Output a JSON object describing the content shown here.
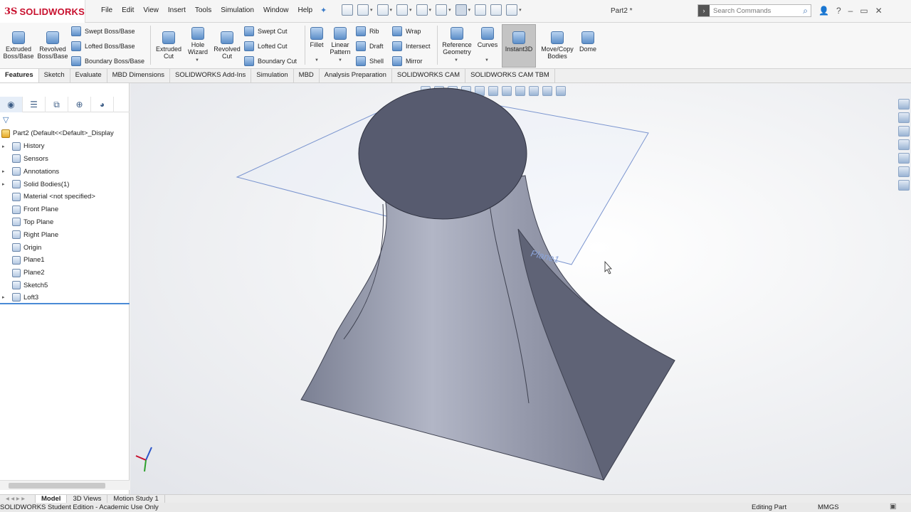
{
  "app": {
    "logo_ds": "3S",
    "logo_name": "SOLIDWORKS",
    "doc_title": "Part2 *"
  },
  "menu": [
    "File",
    "Edit",
    "View",
    "Insert",
    "Tools",
    "Simulation",
    "Window",
    "Help"
  ],
  "search": {
    "placeholder": "Search Commands"
  },
  "ribbon": {
    "extruded_boss": "Extruded Boss/Base",
    "revolved_boss": "Revolved Boss/Base",
    "swept_boss": "Swept Boss/Base",
    "lofted_boss": "Lofted Boss/Base",
    "boundary_boss": "Boundary Boss/Base",
    "extruded_cut": "Extruded Cut",
    "hole_wizard": "Hole Wizard",
    "revolved_cut": "Revolved Cut",
    "swept_cut": "Swept Cut",
    "lofted_cut": "Lofted Cut",
    "boundary_cut": "Boundary Cut",
    "fillet": "Fillet",
    "linear_pattern": "Linear Pattern",
    "rib": "Rib",
    "draft": "Draft",
    "shell": "Shell",
    "wrap": "Wrap",
    "intersect": "Intersect",
    "mirror": "Mirror",
    "reference_geometry": "Reference Geometry",
    "curves": "Curves",
    "instant3d": "Instant3D",
    "move_copy": "Move/Copy Bodies",
    "dome": "Dome"
  },
  "tabs": [
    "Features",
    "Sketch",
    "Evaluate",
    "MBD Dimensions",
    "SOLIDWORKS Add-Ins",
    "Simulation",
    "MBD",
    "Analysis Preparation",
    "SOLIDWORKS CAM",
    "SOLIDWORKS CAM TBM"
  ],
  "tree": {
    "root": "Part2  (Default<<Default>_Display",
    "items": [
      {
        "label": "History",
        "expandable": true
      },
      {
        "label": "Sensors",
        "expandable": false
      },
      {
        "label": "Annotations",
        "expandable": true
      },
      {
        "label": "Solid Bodies(1)",
        "expandable": true
      },
      {
        "label": "Material <not specified>",
        "expandable": false
      },
      {
        "label": "Front Plane",
        "expandable": false
      },
      {
        "label": "Top Plane",
        "expandable": false
      },
      {
        "label": "Right Plane",
        "expandable": false
      },
      {
        "label": "Origin",
        "expandable": false
      },
      {
        "label": "Plane1",
        "expandable": false
      },
      {
        "label": "Plane2",
        "expandable": false
      },
      {
        "label": "Sketch5",
        "expandable": false
      },
      {
        "label": "Loft3",
        "expandable": true
      }
    ]
  },
  "viewport": {
    "plane_label": "Plane1"
  },
  "bottom_tabs": [
    "Model",
    "3D Views",
    "Motion Study 1"
  ],
  "status": {
    "edition": "SOLIDWORKS Student Edition - Academic Use Only",
    "mode": "Editing Part",
    "units": "MMGS"
  },
  "colors": {
    "accent": "#c8102e",
    "selection": "#4a8ad6",
    "body": "#8e93a6",
    "top_face": "#555a6e"
  }
}
